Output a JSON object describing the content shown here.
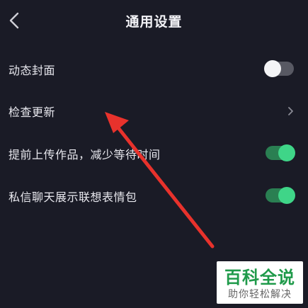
{
  "header": {
    "title": "通用设置",
    "back_icon": "chevron-left-icon"
  },
  "settings": [
    {
      "label": "动态封面",
      "control": "toggle",
      "state": "off"
    },
    {
      "label": "检查更新",
      "control": "chevron",
      "icon": "chevron-right-icon"
    },
    {
      "label": "提前上传作品，减少等待时间",
      "control": "toggle",
      "state": "on"
    },
    {
      "label": "私信聊天展示联想表情包",
      "control": "toggle",
      "state": "on"
    }
  ],
  "colors": {
    "background": "#1a1b26",
    "toggle_on_track": "#2a7f52",
    "toggle_on_knob": "#3fd588",
    "toggle_off_track": "#585963",
    "annotation_arrow": "#e8322c",
    "watermark_green": "#1f9a4a"
  },
  "watermark": {
    "main": "百科全说",
    "sub": "助你轻松解决"
  }
}
